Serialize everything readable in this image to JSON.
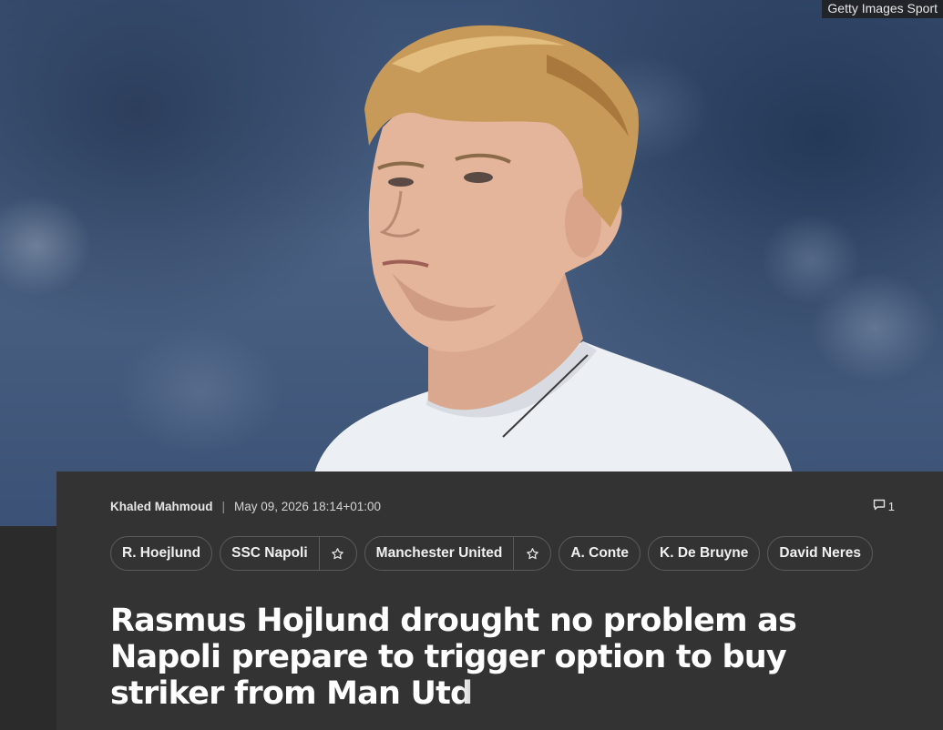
{
  "hero": {
    "credit": "Getty Images Sport",
    "image_subject": "player-photo"
  },
  "article": {
    "author": "Khaled Mahmoud",
    "separator": "|",
    "timestamp": "May 09, 2026 18:14+01:00",
    "comment_count": "1",
    "tags": [
      {
        "label": "R. Hoejlund",
        "followable": false
      },
      {
        "label": "SSC Napoli",
        "followable": true
      },
      {
        "label": "Manchester United",
        "followable": true
      },
      {
        "label": "A. Conte",
        "followable": false
      },
      {
        "label": "K. De Bruyne",
        "followable": false
      },
      {
        "label": "David Neres",
        "followable": false
      }
    ],
    "headline": "Rasmus Hojlund drought no problem as Napoli prepare to trigger option to buy striker from Man Utd"
  },
  "icons": {
    "comment": "comment-icon",
    "follow": "star-icon"
  },
  "colors": {
    "card_background": "#333333",
    "page_background": "#2b2b2b",
    "text_primary": "#ffffff",
    "tag_border": "#5c5c5c"
  }
}
